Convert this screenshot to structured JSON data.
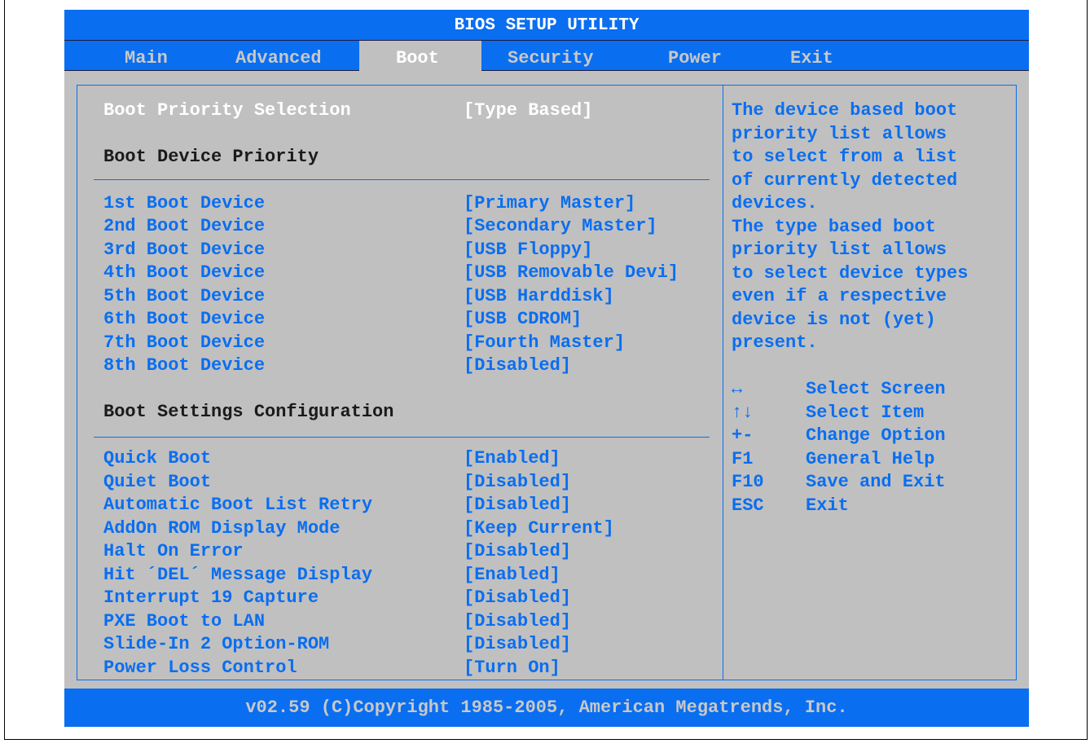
{
  "title": "BIOS SETUP UTILITY",
  "tabs": [
    "Main",
    "Advanced",
    "Boot",
    "Security",
    "Power",
    "Exit"
  ],
  "active_tab": "Boot",
  "boot_priority": {
    "label": "Boot Priority Selection",
    "value": "[Type Based]"
  },
  "sections": {
    "device_priority": "Boot Device Priority",
    "settings": "Boot Settings Configuration"
  },
  "boot_devices": [
    {
      "label": "1st Boot Device",
      "value": "[Primary Master]"
    },
    {
      "label": "2nd Boot Device",
      "value": "[Secondary Master]"
    },
    {
      "label": "3rd Boot Device",
      "value": "[USB Floppy]"
    },
    {
      "label": "4th Boot Device",
      "value": "[USB Removable Devi]"
    },
    {
      "label": "5th Boot Device",
      "value": "[USB Harddisk]"
    },
    {
      "label": "6th Boot Device",
      "value": "[USB CDROM]"
    },
    {
      "label": "7th Boot Device",
      "value": "[Fourth Master]"
    },
    {
      "label": "8th Boot Device",
      "value": "[Disabled]"
    }
  ],
  "boot_settings": [
    {
      "label": "Quick Boot",
      "value": "[Enabled]"
    },
    {
      "label": "Quiet Boot",
      "value": "[Disabled]"
    },
    {
      "label": "Automatic Boot List Retry",
      "value": "[Disabled]"
    },
    {
      "label": "AddOn ROM Display Mode",
      "value": "[Keep Current]"
    },
    {
      "label": "Halt On Error",
      "value": "[Disabled]"
    },
    {
      "label": "Hit ´DEL´ Message Display",
      "value": "[Enabled]"
    },
    {
      "label": "Interrupt 19 Capture",
      "value": "[Disabled]"
    },
    {
      "label": "PXE Boot to LAN",
      "value": "[Disabled]"
    },
    {
      "label": "Slide-In 2 Option-ROM",
      "value": "[Disabled]"
    },
    {
      "label": "Power Loss Control",
      "value": "[Turn On]"
    }
  ],
  "help_text": [
    "The device based boot",
    "priority list allows",
    "to select from a list",
    "of currently detected",
    "devices.",
    "The type based boot",
    "priority list allows",
    "to select device types",
    "even if a respective",
    "device is not (yet)",
    "present."
  ],
  "key_legend": [
    {
      "key": "↔",
      "desc": "Select Screen"
    },
    {
      "key": "↑↓",
      "desc": "Select Item"
    },
    {
      "key": "+-",
      "desc": "Change Option"
    },
    {
      "key": "F1",
      "desc": "General Help"
    },
    {
      "key": "F10",
      "desc": "Save and Exit"
    },
    {
      "key": "ESC",
      "desc": "Exit"
    }
  ],
  "footer": "v02.59 (C)Copyright 1985-2005, American Megatrends, Inc.",
  "colors": {
    "accent": "#0a6ef0",
    "panel": "#c0c0c0"
  }
}
